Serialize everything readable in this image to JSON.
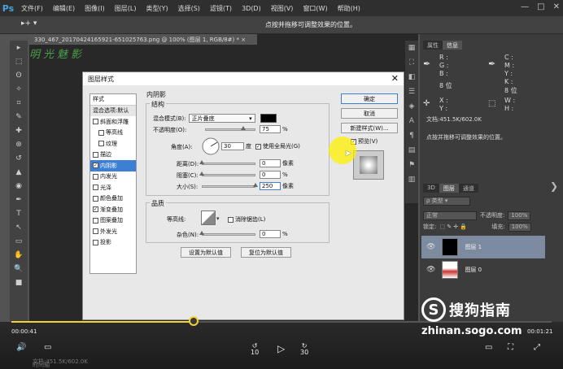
{
  "app": {
    "logo": "Ps"
  },
  "menu": [
    "文件(F)",
    "编辑(E)",
    "图像(I)",
    "图层(L)",
    "类型(Y)",
    "选择(S)",
    "滤镜(T)",
    "3D(D)",
    "视图(V)",
    "窗口(W)",
    "帮助(H)"
  ],
  "window_controls": [
    "—",
    "□",
    "✕"
  ],
  "options_bar": {
    "tool": "▸+ ▾",
    "hint": "点按并拖移可调整效果的位置。"
  },
  "document": {
    "tab_title": "330_467_20170424165921-651025763.png @ 100% (图层 1, RGB/8#) *  ×",
    "watermark": "明光魅影"
  },
  "tools": [
    "▸",
    "⬚",
    "ʘ",
    "✧",
    "⌗",
    "✎",
    "✚",
    "⊛",
    "↺",
    "▲",
    "◉",
    "✒",
    "T",
    "↖",
    "▭",
    "✋",
    "🔍",
    "■"
  ],
  "right_icons": [
    "▦",
    "⛶",
    "◧",
    "☰",
    "◈",
    "A",
    "¶",
    "▤",
    "⚑",
    "▥"
  ],
  "info_panel": {
    "tabs": [
      "属性",
      "信息"
    ],
    "r": "R :",
    "g": "G :",
    "b": "B :",
    "c": "C :",
    "m": "M :",
    "y": "Y :",
    "k": "K :",
    "bit1": "8 位",
    "bit2": "8 位",
    "x": "X :",
    "y_coord": "Y :",
    "w": "W :",
    "h": "H :",
    "doc_info": "文档:451.5K/602.0K",
    "hint": "点按并拖移可调整效果的位置。"
  },
  "layers_panel": {
    "tabs": [
      "3D",
      "图层",
      "通道"
    ],
    "kind": "ρ 类型 ▾",
    "blend": "正常",
    "opacity_label": "不透明度:",
    "opacity": "100%",
    "lock_label": "锁定:",
    "fill_label": "填充:",
    "fill": "100%",
    "layers": [
      {
        "name": "图层 1",
        "selected": true
      },
      {
        "name": "图层 0",
        "selected": false
      }
    ]
  },
  "dialog": {
    "title": "图层样式",
    "close": "✕",
    "styles": [
      {
        "label": "样式",
        "type": "header"
      },
      {
        "label": "混合选项:默认",
        "type": "blend"
      },
      {
        "label": "斜面和浮雕",
        "checked": false
      },
      {
        "label": "等高线",
        "checked": false,
        "indent": true
      },
      {
        "label": "纹理",
        "checked": false,
        "indent": true
      },
      {
        "label": "描边",
        "checked": false
      },
      {
        "label": "内阴影",
        "checked": true,
        "active": true
      },
      {
        "label": "内发光",
        "checked": false
      },
      {
        "label": "光泽",
        "checked": false
      },
      {
        "label": "颜色叠加",
        "checked": false
      },
      {
        "label": "渐变叠加",
        "checked": true
      },
      {
        "label": "图案叠加",
        "checked": false
      },
      {
        "label": "外发光",
        "checked": false
      },
      {
        "label": "投影",
        "checked": false
      }
    ],
    "section_title": "内阴影",
    "structure_title": "结构",
    "blend_mode_label": "混合模式(B):",
    "blend_mode_value": "正片叠底",
    "opacity_label": "不透明度(O):",
    "opacity_value": "75",
    "angle_label": "角度(A):",
    "angle_value": "30",
    "angle_unit": "度",
    "global_light_label": "使用全局光(G)",
    "global_light_checked": true,
    "distance_label": "距离(D):",
    "distance_value": "0",
    "choke_label": "阻塞(C):",
    "choke_value": "0",
    "size_label": "大小(S):",
    "size_value": "250",
    "px_unit": "像素",
    "pct_unit": "%",
    "quality_title": "品质",
    "contour_label": "等高线:",
    "antialias_label": "消除锯齿(L)",
    "noise_label": "杂色(N):",
    "noise_value": "0",
    "set_default": "设置为默认值",
    "reset_default": "复位为默认值",
    "ok": "确定",
    "cancel": "取消",
    "new_style": "新建样式(W)...",
    "preview_label": "预览(V)",
    "sliders": {
      "opacity": 0.75,
      "distance": 0.0,
      "choke": 0.0,
      "size": 1.0,
      "noise": 0.0
    }
  },
  "player": {
    "current_time": "00:00:41",
    "total_time": "00:01:21",
    "progress": 0.51,
    "rewind": "↺\n10",
    "forward": "↻\n30",
    "play": "▷",
    "bottom_text": "文档:451.5K/602.0K",
    "time_label": "时间轴",
    "volume": "🔊",
    "subtitle": "▭",
    "extra_icons": [
      "▭",
      "⛶",
      "⤢"
    ]
  },
  "brand": {
    "name": "搜狗指南",
    "logo": "S",
    "url": "zhinan.sogo.com"
  }
}
